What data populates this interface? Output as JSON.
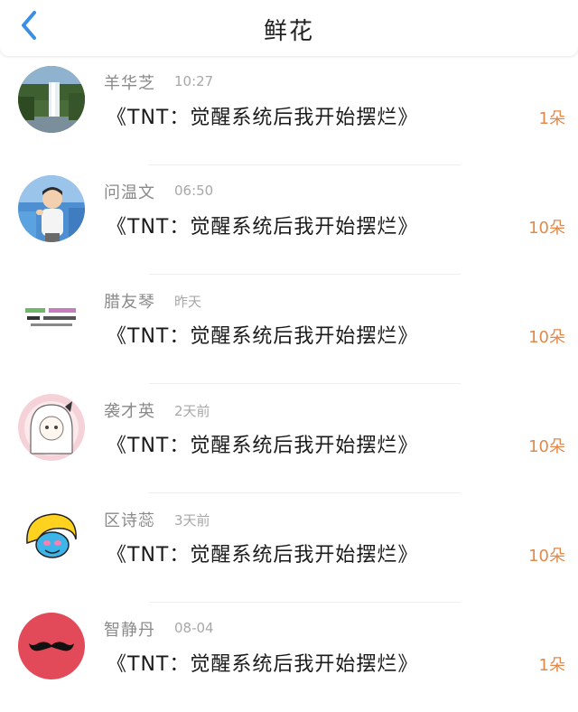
{
  "header": {
    "title": "鲜花",
    "back_icon": "chevron-left-icon"
  },
  "colors": {
    "accent": "#3a8ee6",
    "count": "#e2894a"
  },
  "items": [
    {
      "name": "羊华芝",
      "time": "10:27",
      "book": "《TNT：觉醒系统后我开始摆烂》",
      "count": "1朵",
      "avatar": "waterfall-photo"
    },
    {
      "name": "问温文",
      "time": "06:50",
      "book": "《TNT：觉醒系统后我开始摆烂》",
      "count": "10朵",
      "avatar": "child-photo"
    },
    {
      "name": "腊友琴",
      "time": "昨天",
      "book": "《TNT：觉醒系统后我开始摆烂》",
      "count": "10朵",
      "avatar": "text-sticker"
    },
    {
      "name": "袭才英",
      "time": "2天前",
      "book": "《TNT：觉醒系统后我开始摆烂》",
      "count": "10朵",
      "avatar": "anime-girl-drawing"
    },
    {
      "name": "区诗蕊",
      "time": "3天前",
      "book": "《TNT：觉醒系统后我开始摆烂》",
      "count": "10朵",
      "avatar": "cartoon-character"
    },
    {
      "name": "智静丹",
      "time": "08-04",
      "book": "《TNT：觉醒系统后我开始摆烂》",
      "count": "1朵",
      "avatar": "mustache-icon"
    }
  ]
}
